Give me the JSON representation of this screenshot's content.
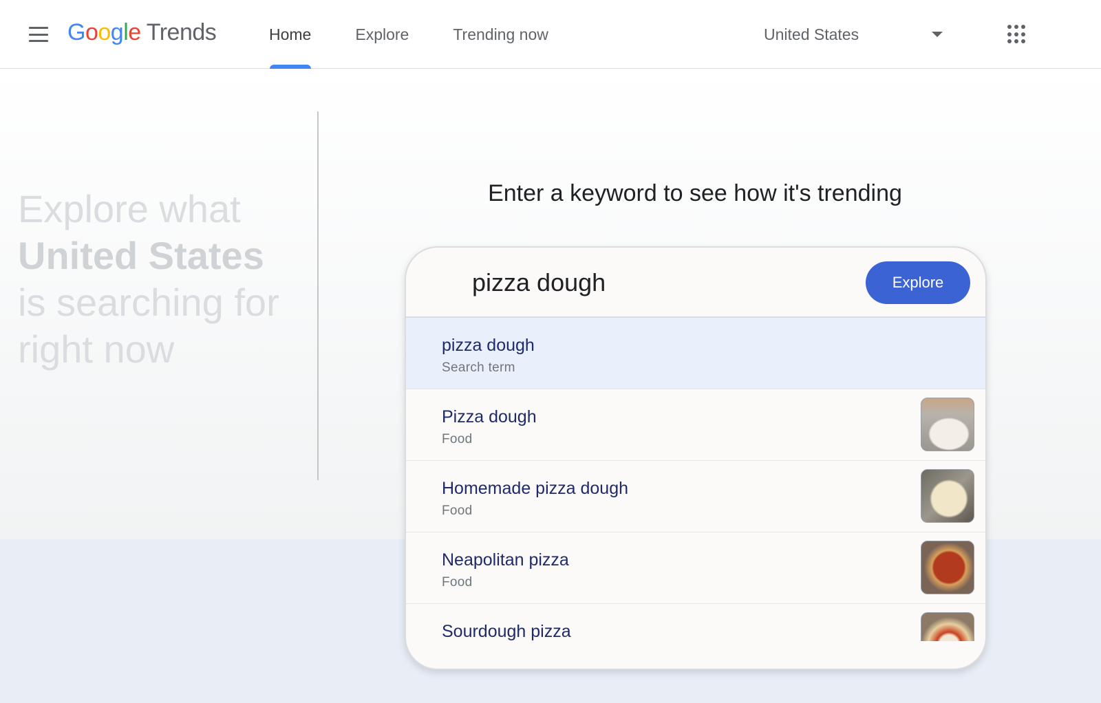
{
  "header": {
    "logo_google": [
      "G",
      "o",
      "o",
      "g",
      "l",
      "e"
    ],
    "logo_trends": "Trends",
    "nav": [
      {
        "label": "Home",
        "active": true
      },
      {
        "label": "Explore",
        "active": false
      },
      {
        "label": "Trending now",
        "active": false
      }
    ],
    "country": "United States"
  },
  "hero": {
    "tagline_pre": "Explore what",
    "tagline_country": "United States",
    "tagline_post": "is searching for right now",
    "prompt": "Enter a keyword to see how it's trending"
  },
  "search": {
    "value": "pizza dough",
    "button_label": "Explore",
    "suggestions": [
      {
        "title": "pizza dough",
        "subtitle": "Search term",
        "highlighted": true
      },
      {
        "title": "Pizza dough",
        "subtitle": "Food",
        "image": "dough-ball"
      },
      {
        "title": "Homemade pizza dough",
        "subtitle": "Food",
        "image": "dough-ball-bowl"
      },
      {
        "title": "Neapolitan pizza",
        "subtitle": "Food",
        "image": "pepperoni-pizza"
      },
      {
        "title": "Sourdough pizza",
        "subtitle": "",
        "image": "margherita-pizza"
      }
    ]
  },
  "colors": {
    "accent": "#4285f4",
    "button": "#3b63d4",
    "highlight_row": "#e9f0fc"
  },
  "icons": {
    "menu": "hamburger-menu-icon",
    "dropdown": "caret-down-icon",
    "apps": "apps-grid-icon"
  }
}
